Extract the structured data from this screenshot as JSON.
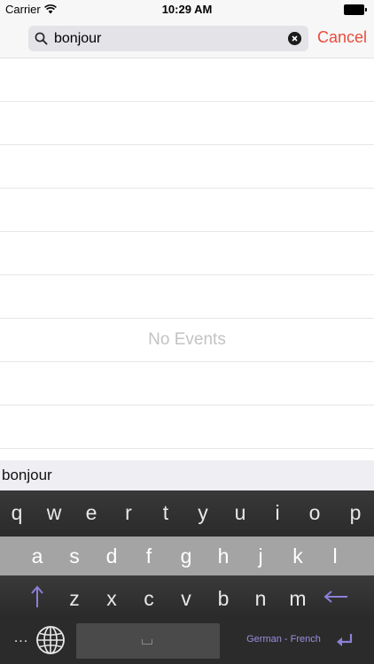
{
  "status_bar": {
    "carrier": "Carrier",
    "time": "10:29 AM"
  },
  "search": {
    "value": "bonjour",
    "cancel_label": "Cancel"
  },
  "events": {
    "empty_label": "No Events"
  },
  "suggestion": {
    "word": "bonjour"
  },
  "keyboard": {
    "row1": [
      "q",
      "w",
      "e",
      "r",
      "t",
      "y",
      "u",
      "i",
      "o",
      "p"
    ],
    "row2": [
      "a",
      "s",
      "d",
      "f",
      "g",
      "h",
      "j",
      "k",
      "l"
    ],
    "row3": [
      "z",
      "x",
      "c",
      "v",
      "b",
      "n",
      "m"
    ],
    "more_label": "...",
    "language_label": "German - French"
  },
  "colors": {
    "accent": "#e74c3c",
    "language_label": "#9a8fe0",
    "arrow_keys": "#8b80d8"
  },
  "icons": {
    "search": "magnifier-icon",
    "clear": "clear-icon",
    "shift": "shift-arrow-icon",
    "backspace": "backspace-arrow-icon",
    "globe": "globe-icon",
    "return": "return-icon"
  }
}
